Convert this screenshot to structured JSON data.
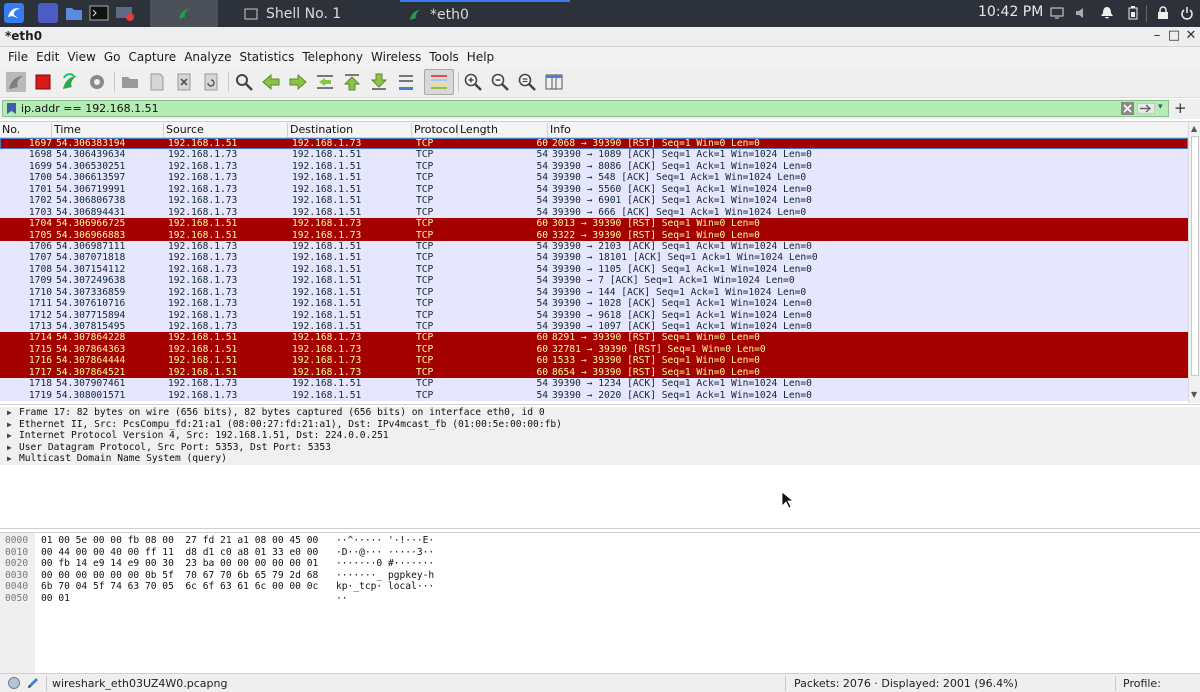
{
  "taskbar": {
    "tasks": [
      "Shell No. 1",
      "*eth0"
    ],
    "clock": "10:42 PM"
  },
  "window": {
    "title": "*eth0"
  },
  "menu": [
    "File",
    "Edit",
    "View",
    "Go",
    "Capture",
    "Analyze",
    "Statistics",
    "Telephony",
    "Wireless",
    "Tools",
    "Help"
  ],
  "filter": {
    "value": "ip.addr == 192.168.1.51"
  },
  "columns": {
    "no": "No.",
    "time": "Time",
    "source": "Source",
    "destination": "Destination",
    "protocol": "Protocol",
    "length": "Length",
    "info": "Info"
  },
  "packets": [
    {
      "no": "1697",
      "time": "54.306383194",
      "src": "192.168.1.51",
      "dst": "192.168.1.73",
      "proto": "TCP",
      "len": "60",
      "info": "2068 → 39390 [RST] Seq=1 Win=0 Len=0",
      "style": "sel"
    },
    {
      "no": "1698",
      "time": "54.306439634",
      "src": "192.168.1.73",
      "dst": "192.168.1.51",
      "proto": "TCP",
      "len": "54",
      "info": "39390 → 1089 [ACK] Seq=1 Ack=1 Win=1024 Len=0",
      "style": "ack"
    },
    {
      "no": "1699",
      "time": "54.306530251",
      "src": "192.168.1.73",
      "dst": "192.168.1.51",
      "proto": "TCP",
      "len": "54",
      "info": "39390 → 8086 [ACK] Seq=1 Ack=1 Win=1024 Len=0",
      "style": "ack"
    },
    {
      "no": "1700",
      "time": "54.306613597",
      "src": "192.168.1.73",
      "dst": "192.168.1.51",
      "proto": "TCP",
      "len": "54",
      "info": "39390 → 548 [ACK] Seq=1 Ack=1 Win=1024 Len=0",
      "style": "ack"
    },
    {
      "no": "1701",
      "time": "54.306719991",
      "src": "192.168.1.73",
      "dst": "192.168.1.51",
      "proto": "TCP",
      "len": "54",
      "info": "39390 → 5560 [ACK] Seq=1 Ack=1 Win=1024 Len=0",
      "style": "ack"
    },
    {
      "no": "1702",
      "time": "54.306806738",
      "src": "192.168.1.73",
      "dst": "192.168.1.51",
      "proto": "TCP",
      "len": "54",
      "info": "39390 → 6901 [ACK] Seq=1 Ack=1 Win=1024 Len=0",
      "style": "ack"
    },
    {
      "no": "1703",
      "time": "54.306894431",
      "src": "192.168.1.73",
      "dst": "192.168.1.51",
      "proto": "TCP",
      "len": "54",
      "info": "39390 → 666 [ACK] Seq=1 Ack=1 Win=1024 Len=0",
      "style": "ack"
    },
    {
      "no": "1704",
      "time": "54.306966725",
      "src": "192.168.1.51",
      "dst": "192.168.1.73",
      "proto": "TCP",
      "len": "60",
      "info": "3013 → 39390 [RST] Seq=1 Win=0 Len=0",
      "style": "rst"
    },
    {
      "no": "1705",
      "time": "54.306966883",
      "src": "192.168.1.51",
      "dst": "192.168.1.73",
      "proto": "TCP",
      "len": "60",
      "info": "3322 → 39390 [RST] Seq=1 Win=0 Len=0",
      "style": "rst"
    },
    {
      "no": "1706",
      "time": "54.306987111",
      "src": "192.168.1.73",
      "dst": "192.168.1.51",
      "proto": "TCP",
      "len": "54",
      "info": "39390 → 2103 [ACK] Seq=1 Ack=1 Win=1024 Len=0",
      "style": "ack"
    },
    {
      "no": "1707",
      "time": "54.307071818",
      "src": "192.168.1.73",
      "dst": "192.168.1.51",
      "proto": "TCP",
      "len": "54",
      "info": "39390 → 18101 [ACK] Seq=1 Ack=1 Win=1024 Len=0",
      "style": "ack"
    },
    {
      "no": "1708",
      "time": "54.307154112",
      "src": "192.168.1.73",
      "dst": "192.168.1.51",
      "proto": "TCP",
      "len": "54",
      "info": "39390 → 1105 [ACK] Seq=1 Ack=1 Win=1024 Len=0",
      "style": "ack"
    },
    {
      "no": "1709",
      "time": "54.307249638",
      "src": "192.168.1.73",
      "dst": "192.168.1.51",
      "proto": "TCP",
      "len": "54",
      "info": "39390 → 7 [ACK] Seq=1 Ack=1 Win=1024 Len=0",
      "style": "ack"
    },
    {
      "no": "1710",
      "time": "54.307336859",
      "src": "192.168.1.73",
      "dst": "192.168.1.51",
      "proto": "TCP",
      "len": "54",
      "info": "39390 → 144 [ACK] Seq=1 Ack=1 Win=1024 Len=0",
      "style": "ack"
    },
    {
      "no": "1711",
      "time": "54.307610716",
      "src": "192.168.1.73",
      "dst": "192.168.1.51",
      "proto": "TCP",
      "len": "54",
      "info": "39390 → 1028 [ACK] Seq=1 Ack=1 Win=1024 Len=0",
      "style": "ack"
    },
    {
      "no": "1712",
      "time": "54.307715894",
      "src": "192.168.1.73",
      "dst": "192.168.1.51",
      "proto": "TCP",
      "len": "54",
      "info": "39390 → 9618 [ACK] Seq=1 Ack=1 Win=1024 Len=0",
      "style": "ack"
    },
    {
      "no": "1713",
      "time": "54.307815495",
      "src": "192.168.1.73",
      "dst": "192.168.1.51",
      "proto": "TCP",
      "len": "54",
      "info": "39390 → 1097 [ACK] Seq=1 Ack=1 Win=1024 Len=0",
      "style": "ack"
    },
    {
      "no": "1714",
      "time": "54.307864228",
      "src": "192.168.1.51",
      "dst": "192.168.1.73",
      "proto": "TCP",
      "len": "60",
      "info": "8291 → 39390 [RST] Seq=1 Win=0 Len=0",
      "style": "rst"
    },
    {
      "no": "1715",
      "time": "54.307864363",
      "src": "192.168.1.51",
      "dst": "192.168.1.73",
      "proto": "TCP",
      "len": "60",
      "info": "32781 → 39390 [RST] Seq=1 Win=0 Len=0",
      "style": "rst"
    },
    {
      "no": "1716",
      "time": "54.307864444",
      "src": "192.168.1.51",
      "dst": "192.168.1.73",
      "proto": "TCP",
      "len": "60",
      "info": "1533 → 39390 [RST] Seq=1 Win=0 Len=0",
      "style": "rst"
    },
    {
      "no": "1717",
      "time": "54.307864521",
      "src": "192.168.1.51",
      "dst": "192.168.1.73",
      "proto": "TCP",
      "len": "60",
      "info": "8654 → 39390 [RST] Seq=1 Win=0 Len=0",
      "style": "rst"
    },
    {
      "no": "1718",
      "time": "54.307907461",
      "src": "192.168.1.73",
      "dst": "192.168.1.51",
      "proto": "TCP",
      "len": "54",
      "info": "39390 → 1234 [ACK] Seq=1 Ack=1 Win=1024 Len=0",
      "style": "ack"
    },
    {
      "no": "1719",
      "time": "54.308001571",
      "src": "192.168.1.73",
      "dst": "192.168.1.51",
      "proto": "TCP",
      "len": "54",
      "info": "39390 → 2020 [ACK] Seq=1 Ack=1 Win=1024 Len=0",
      "style": "ack"
    }
  ],
  "details": [
    "Frame 17: 82 bytes on wire (656 bits), 82 bytes captured (656 bits) on interface eth0, id 0",
    "Ethernet II, Src: PcsCompu_fd:21:a1 (08:00:27:fd:21:a1), Dst: IPv4mcast_fb (01:00:5e:00:00:fb)",
    "Internet Protocol Version 4, Src: 192.168.1.51, Dst: 224.0.0.251",
    "User Datagram Protocol, Src Port: 5353, Dst Port: 5353",
    "Multicast Domain Name System (query)"
  ],
  "bytes": [
    {
      "off": "0000",
      "hex": "01 00 5e 00 00 fb 08 00  27 fd 21 a1 08 00 45 00",
      "ascii": "··^····· '·!···E·"
    },
    {
      "off": "0010",
      "hex": "00 44 00 00 40 00 ff 11  d8 d1 c0 a8 01 33 e0 00",
      "ascii": "·D··@··· ·····3··"
    },
    {
      "off": "0020",
      "hex": "00 fb 14 e9 14 e9 00 30  23 ba 00 00 00 00 00 01",
      "ascii": "·······0 #·······"
    },
    {
      "off": "0030",
      "hex": "00 00 00 00 00 00 0b 5f  70 67 70 6b 65 79 2d 68",
      "ascii": "·······_ pgpkey-h"
    },
    {
      "off": "0040",
      "hex": "6b 70 04 5f 74 63 70 05  6c 6f 63 61 6c 00 00 0c",
      "ascii": "kp·_tcp· local···"
    },
    {
      "off": "0050",
      "hex": "00 01",
      "ascii": "··"
    }
  ],
  "status": {
    "file": "wireshark_eth03UZ4W0.pcapng",
    "packets": "Packets: 2076 · Displayed: 2001 (96.4%)",
    "profile": "Profile: Default"
  },
  "colors": {
    "rst_bg": "#a40000",
    "rst_fg": "#fffc9c",
    "ack_bg": "#e7e6ff",
    "filter_ok": "#b4ecb4"
  }
}
